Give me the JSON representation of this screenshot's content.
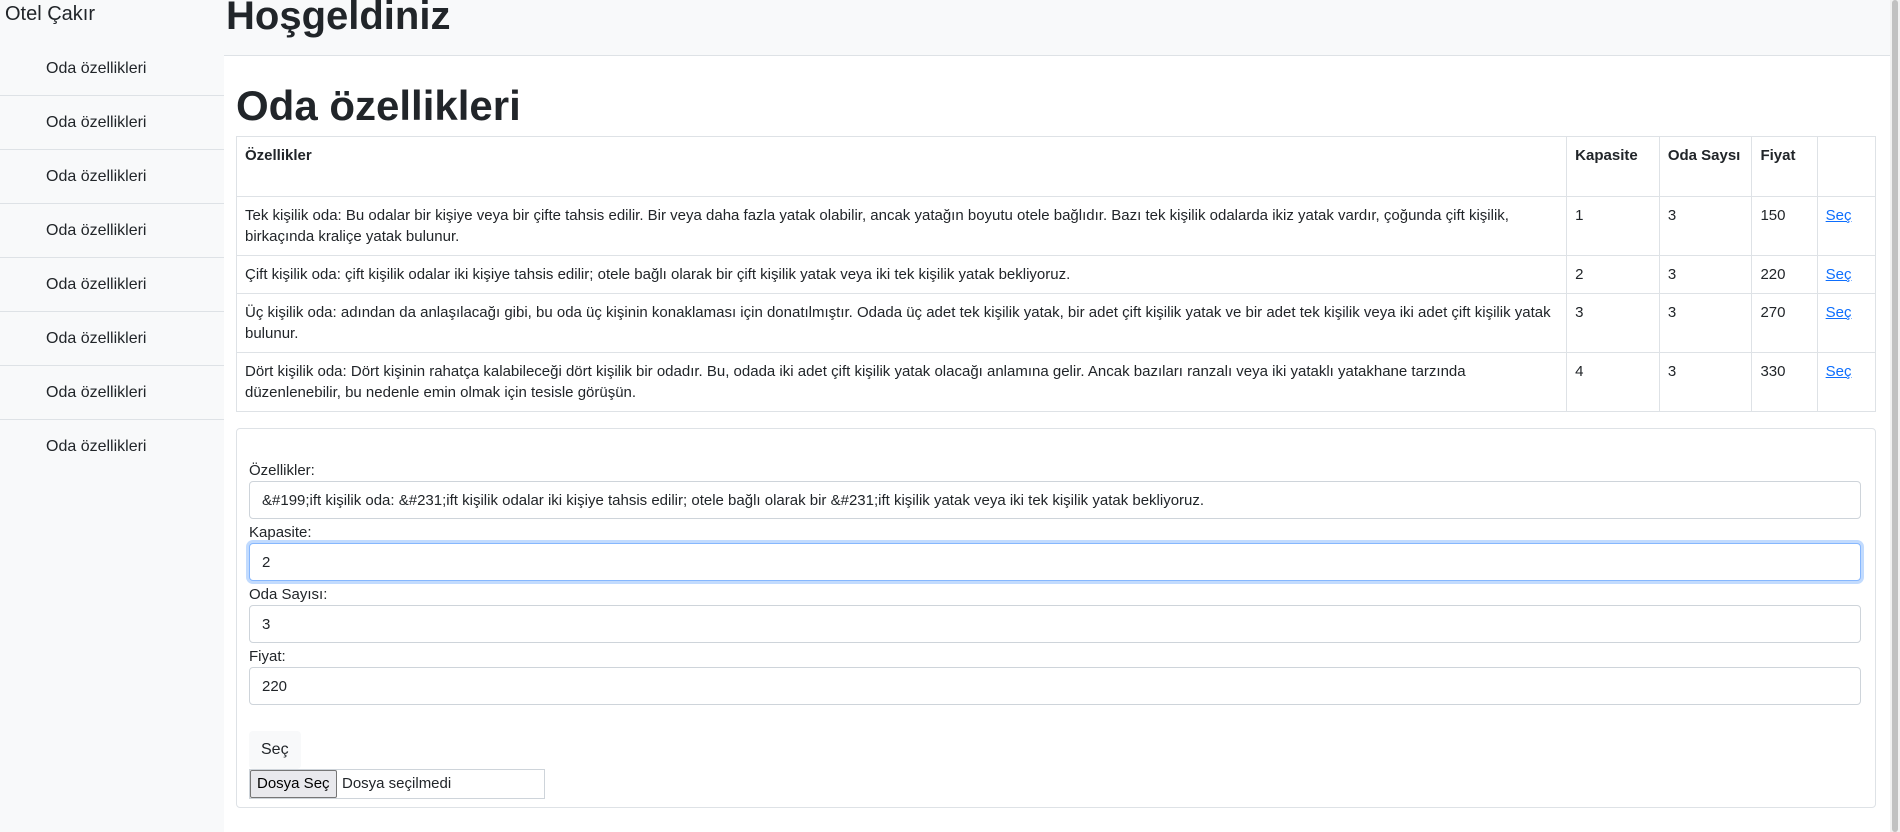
{
  "brand": "Otel Çakır",
  "sidebar": {
    "items": [
      {
        "label": "Oda özellikleri"
      },
      {
        "label": "Oda özellikleri"
      },
      {
        "label": "Oda özellikleri"
      },
      {
        "label": "Oda özellikleri"
      },
      {
        "label": "Oda özellikleri"
      },
      {
        "label": "Oda özellikleri"
      },
      {
        "label": "Oda özellikleri"
      },
      {
        "label": "Oda özellikleri"
      }
    ]
  },
  "header": {
    "welcome": "Hoşgeldiniz"
  },
  "main": {
    "title": "Oda özellikleri",
    "table": {
      "headers": {
        "features": "Özellikler",
        "capacity": "Kapasite",
        "rooms": "Oda Saysı",
        "price": "Fiyat",
        "select": ""
      },
      "rows": [
        {
          "features": "Tek kişilik oda: Bu odalar bir kişiye veya bir çifte tahsis edilir. Bir veya daha fazla yatak olabilir, ancak yatağın boyutu otele bağlıdır. Bazı tek kişilik odalarda ikiz yatak vardır, çoğunda çift kişilik, birkaçında kraliçe yatak bulunur.",
          "capacity": "1",
          "rooms": "3",
          "price": "150",
          "select": "Seç"
        },
        {
          "features": "Çift kişilik oda: çift kişilik odalar iki kişiye tahsis edilir; otele bağlı olarak bir çift kişilik yatak veya iki tek kişilik yatak bekliyoruz.",
          "capacity": "2",
          "rooms": "3",
          "price": "220",
          "select": "Seç"
        },
        {
          "features": "Üç kişilik oda: adından da anlaşılacağı gibi, bu oda üç kişinin konaklaması için donatılmıştır. Odada üç adet tek kişilik yatak, bir adet çift kişilik yatak ve bir adet tek kişilik veya iki adet çift kişilik yatak bulunur.",
          "capacity": "3",
          "rooms": "3",
          "price": "270",
          "select": "Seç"
        },
        {
          "features": "Dört kişilik oda: Dört kişinin rahatça kalabileceği dört kişilik bir odadır. Bu, odada iki adet çift kişilik yatak olacağı anlamına gelir. Ancak bazıları ranzalı veya iki yataklı yatakhane tarzında düzenlenebilir, bu nedenle emin olmak için tesisle görüşün.",
          "capacity": "4",
          "rooms": "3",
          "price": "330",
          "select": "Seç"
        }
      ]
    }
  },
  "form": {
    "features_label": "Özellikler:",
    "features_value": "&#199;ift kişilik oda: &#231;ift kişilik odalar iki kişiye tahsis edilir; otele bağlı olarak bir &#231;ift kişilik yatak veya iki tek kişilik yatak bekliyoruz.",
    "capacity_label": "Kapasite:",
    "capacity_value": "2",
    "rooms_label": "Oda Sayısı:",
    "rooms_value": "3",
    "price_label": "Fiyat:",
    "price_value": "220",
    "select_button": "Seç",
    "file_button": "Dosya Seç",
    "file_status": "Dosya seçilmedi"
  }
}
